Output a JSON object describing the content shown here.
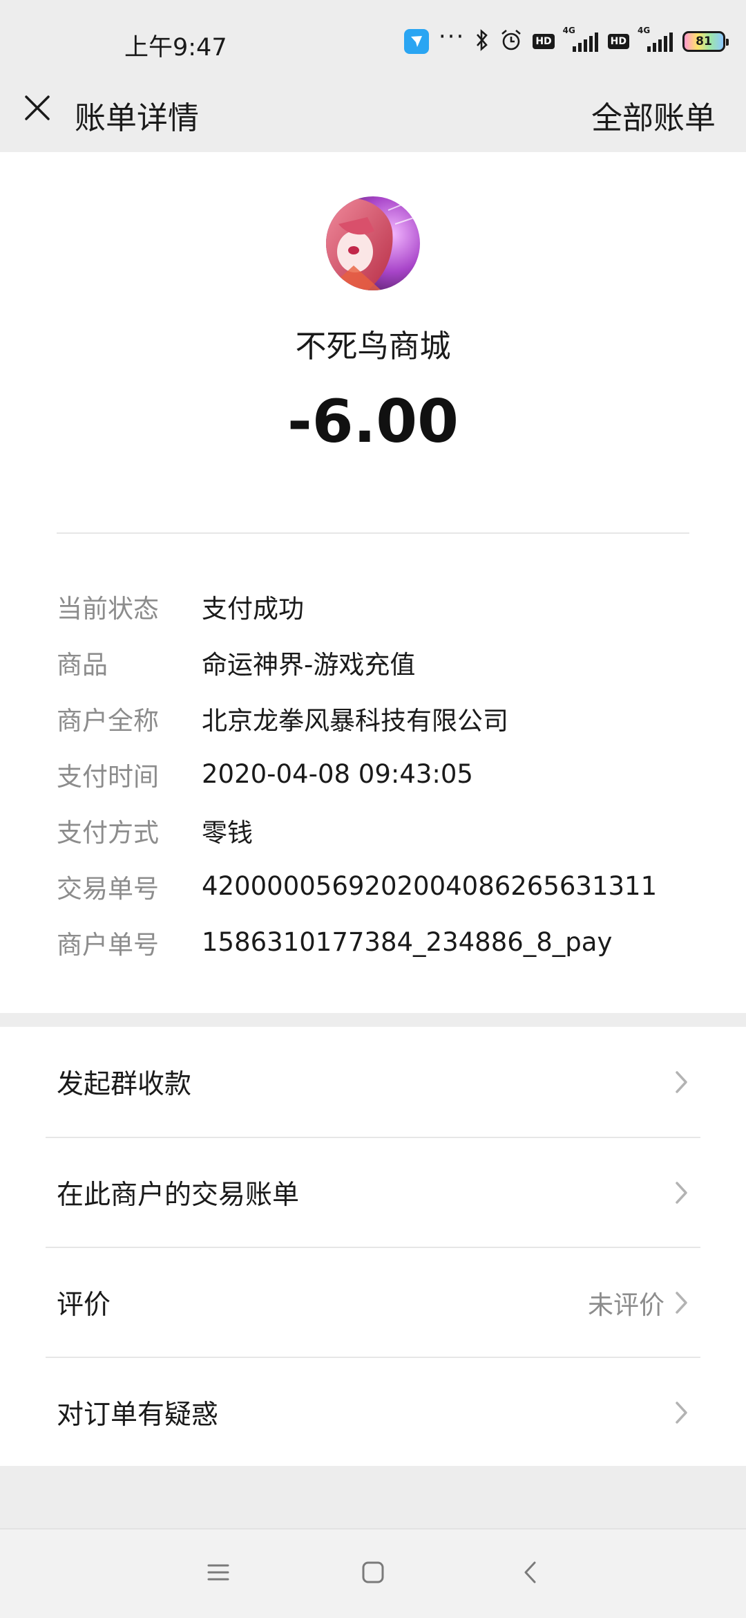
{
  "status_bar": {
    "time": "上午9:47",
    "battery_level": "81",
    "network": "4G",
    "hd_label": "HD"
  },
  "nav": {
    "title": "账单详情",
    "right_action": "全部账单"
  },
  "merchant": {
    "name": "不死鸟商城",
    "amount": "-6.00"
  },
  "details": [
    {
      "label": "当前状态",
      "value": "支付成功"
    },
    {
      "label": "商品",
      "value": "命运神界-游戏充值"
    },
    {
      "label": "商户全称",
      "value": "北京龙拳风暴科技有限公司"
    },
    {
      "label": "支付时间",
      "value": "2020-04-08 09:43:05"
    },
    {
      "label": "支付方式",
      "value": "零钱"
    },
    {
      "label": "交易单号",
      "value": "4200000569202004086265631311"
    },
    {
      "label": "商户单号",
      "value": "1586310177384_234886_8_pay"
    }
  ],
  "actions": [
    {
      "label": "发起群收款",
      "value": ""
    },
    {
      "label": "在此商户的交易账单",
      "value": ""
    },
    {
      "label": "评价",
      "value": "未评价"
    },
    {
      "label": "对订单有疑惑",
      "value": ""
    }
  ],
  "icons": {
    "close": "close-icon",
    "chevron": "chevron-right-icon",
    "menu": "menu-icon",
    "home": "home-icon",
    "back": "back-icon"
  },
  "colors": {
    "background": "#ededed",
    "card": "#ffffff",
    "label_gray": "#8c8c8c",
    "text": "#1a1a1a"
  }
}
